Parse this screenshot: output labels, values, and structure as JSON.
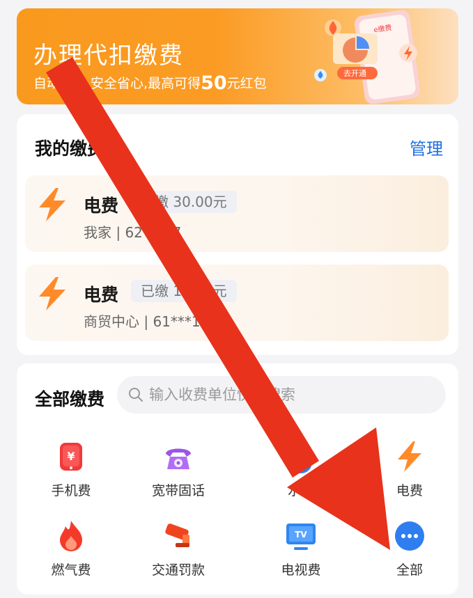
{
  "banner": {
    "title": "办理代扣缴费",
    "subtitle_prefix": "自动扣费,安全省心,最高可得",
    "subtitle_amount": "50",
    "subtitle_suffix": "元红包",
    "illustration_tag": "e缴费",
    "illustration_button": "去开通"
  },
  "my_bills": {
    "title": "我的缴费",
    "manage_label": "管理",
    "items": [
      {
        "name": "电费",
        "badge": "已缴 30.00元",
        "account": "我家 | 62***17"
      },
      {
        "name": "电费",
        "badge": "已缴 10.00元",
        "account": "商贸中心 | 61***17"
      }
    ]
  },
  "all_payments": {
    "title": "全部缴费",
    "search_placeholder": "输入收费单位快速搜索",
    "categories": [
      {
        "label": "手机费",
        "icon": "mobile-fee-icon"
      },
      {
        "label": "宽带固话",
        "icon": "telephone-icon"
      },
      {
        "label": "水费",
        "icon": "water-drop-icon"
      },
      {
        "label": "电费",
        "icon": "lightning-icon"
      },
      {
        "label": "燃气费",
        "icon": "flame-icon"
      },
      {
        "label": "交通罚款",
        "icon": "traffic-camera-icon"
      },
      {
        "label": "电视费",
        "icon": "tv-icon"
      },
      {
        "label": "全部",
        "icon": "more-dots-icon"
      }
    ]
  },
  "colors": {
    "banner_orange": "#f99a1e",
    "link_blue": "#1f6fe0",
    "arrow_red": "#e8321c"
  }
}
